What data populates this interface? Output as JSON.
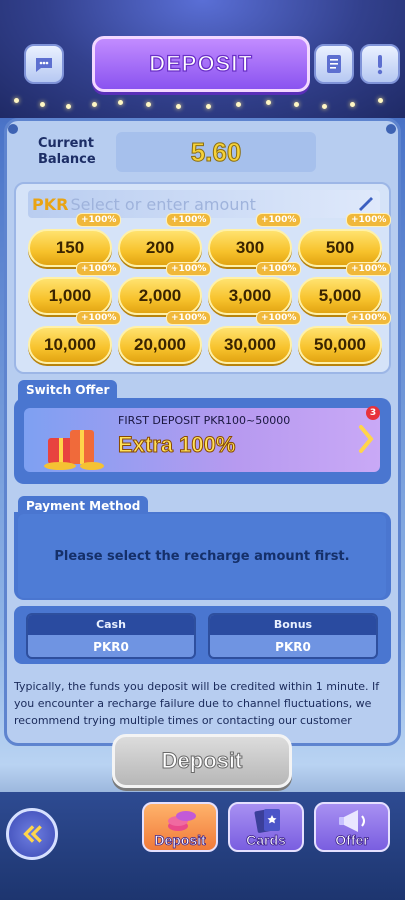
{
  "header": {
    "title": "DEPOSIT"
  },
  "balance": {
    "label": "Current Balance",
    "value": "5.60"
  },
  "amount": {
    "currency": "PKR",
    "placeholder": "Select or enter amount",
    "options": [
      {
        "value": "150",
        "bonus": "+100%"
      },
      {
        "value": "200",
        "bonus": "+100%"
      },
      {
        "value": "300",
        "bonus": "+100%"
      },
      {
        "value": "500",
        "bonus": "+100%"
      },
      {
        "value": "1,000",
        "bonus": "+100%"
      },
      {
        "value": "2,000",
        "bonus": "+100%"
      },
      {
        "value": "3,000",
        "bonus": "+100%"
      },
      {
        "value": "5,000",
        "bonus": "+100%"
      },
      {
        "value": "10,000",
        "bonus": "+100%"
      },
      {
        "value": "20,000",
        "bonus": "+100%"
      },
      {
        "value": "30,000",
        "bonus": "+100%"
      },
      {
        "value": "50,000",
        "bonus": "+100%"
      }
    ]
  },
  "offer": {
    "section_title": "Switch Offer",
    "subtitle": "FIRST DEPOSIT  PKR100~50000",
    "headline": "Extra 100%",
    "badge_count": "3"
  },
  "payment": {
    "section_title": "Payment Method",
    "message": "Please select the recharge amount first."
  },
  "wallet": {
    "cash_label": "Cash",
    "cash_value": "PKR0",
    "bonus_label": "Bonus",
    "bonus_value": "PKR0"
  },
  "notice": "Typically, the funds you deposit will be credited within 1 minute. If you encounter a recharge failure due to channel fluctuations, we recommend trying multiple times or contacting our customer",
  "deposit_button": "Deposit",
  "nav": {
    "tabs": [
      "Deposit",
      "Cards",
      "Offer"
    ]
  }
}
